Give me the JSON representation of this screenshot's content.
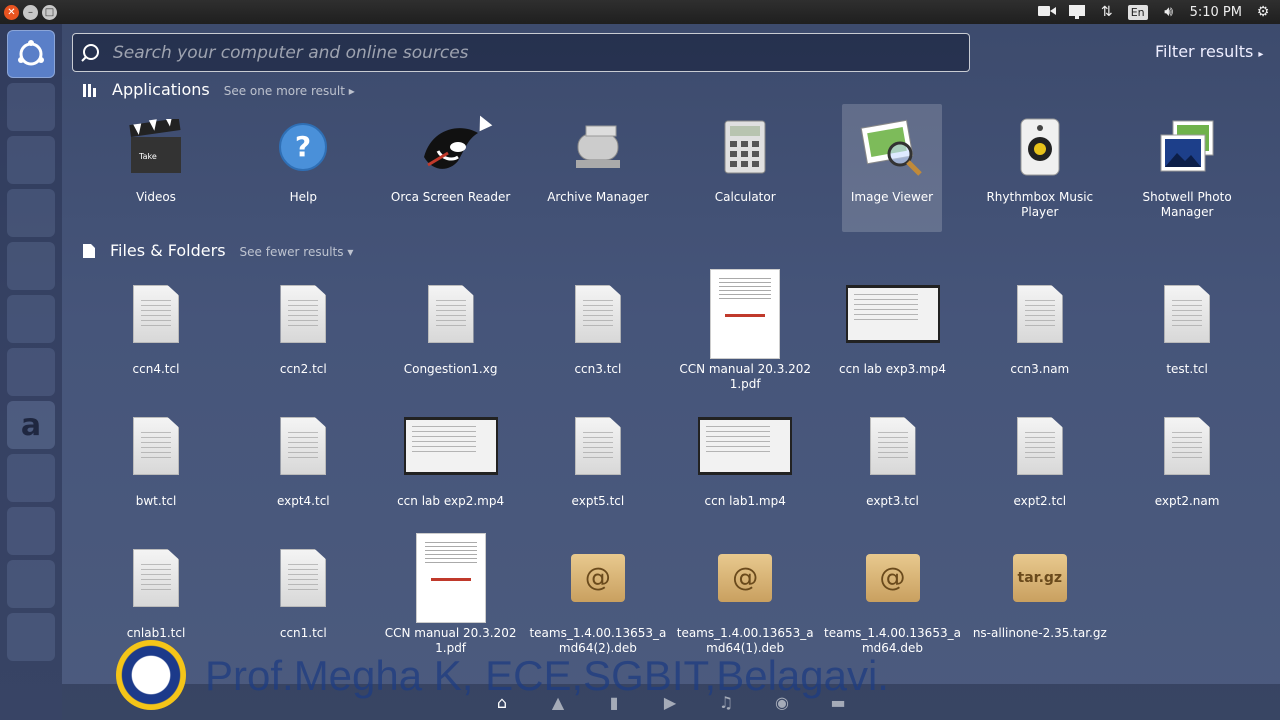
{
  "top_panel": {
    "window_buttons": [
      "close",
      "minimize",
      "maximize"
    ],
    "indicators": {
      "camera": "video-camera-icon",
      "display": "display-icon",
      "network": "network-arrows-icon",
      "language": "En",
      "volume": "volume-icon",
      "settings": "gear-icon"
    },
    "clock": "5:10 PM"
  },
  "launcher": {
    "items": [
      "dash-icon",
      "files-icon",
      "backup-icon",
      "writer-icon",
      "calc-icon",
      "impress-icon",
      "software-center-icon",
      "amazon-icon",
      "system-settings-icon",
      "text-editor-icon",
      "terminal-icon",
      "workspaces-icon"
    ]
  },
  "search": {
    "placeholder": "Search your computer and online sources",
    "value": ""
  },
  "filter_results": "Filter results",
  "applications": {
    "title": "Applications",
    "more": "See one more result",
    "items": [
      {
        "label": "Videos",
        "icon": "clapperboard-icon"
      },
      {
        "label": "Help",
        "icon": "help-icon"
      },
      {
        "label": "Orca Screen Reader",
        "icon": "orca-icon"
      },
      {
        "label": "Archive Manager",
        "icon": "archive-icon"
      },
      {
        "label": "Calculator",
        "icon": "calculator-icon"
      },
      {
        "label": "Image Viewer",
        "icon": "image-viewer-icon"
      },
      {
        "label": "Rhythmbox Music Player",
        "icon": "speaker-icon"
      },
      {
        "label": "Shotwell Photo Manager",
        "icon": "photos-icon"
      }
    ]
  },
  "files": {
    "title": "Files & Folders",
    "fewer": "See fewer results",
    "items": [
      {
        "label": "ccn4.tcl",
        "kind": "doc"
      },
      {
        "label": "ccn2.tcl",
        "kind": "doc"
      },
      {
        "label": "Congestion1.xg",
        "kind": "doc"
      },
      {
        "label": "ccn3.tcl",
        "kind": "doc"
      },
      {
        "label": "CCN manual 20.3.2021.pdf",
        "kind": "pdf"
      },
      {
        "label": "ccn lab exp3.mp4",
        "kind": "video"
      },
      {
        "label": "ccn3.nam",
        "kind": "doc"
      },
      {
        "label": "test.tcl",
        "kind": "doc"
      },
      {
        "label": "bwt.tcl",
        "kind": "doc"
      },
      {
        "label": "expt4.tcl",
        "kind": "doc"
      },
      {
        "label": "ccn lab exp2.mp4",
        "kind": "video"
      },
      {
        "label": "expt5.tcl",
        "kind": "doc"
      },
      {
        "label": "ccn lab1.mp4",
        "kind": "video"
      },
      {
        "label": "expt3.tcl",
        "kind": "doc"
      },
      {
        "label": "expt2.tcl",
        "kind": "doc"
      },
      {
        "label": "expt2.nam",
        "kind": "doc"
      },
      {
        "label": "cnlab1.tcl",
        "kind": "doc"
      },
      {
        "label": "ccn1.tcl",
        "kind": "doc"
      },
      {
        "label": "CCN manual 20.3.2021.pdf",
        "kind": "pdf"
      },
      {
        "label": "teams_1.4.00.13653_amd64(2).deb",
        "kind": "deb"
      },
      {
        "label": "teams_1.4.00.13653_amd64(1).deb",
        "kind": "deb"
      },
      {
        "label": "teams_1.4.00.13653_amd64.deb",
        "kind": "deb"
      },
      {
        "label": "ns-allinone-2.35.tar.gz",
        "kind": "tgz"
      }
    ]
  },
  "bottom_categories": [
    "home-icon",
    "applications-icon",
    "files-icon",
    "video-icon",
    "music-icon",
    "photos-icon",
    "social-icon"
  ],
  "watermark": "Prof.Megha K, ECE,SGBIT,Belagavi."
}
